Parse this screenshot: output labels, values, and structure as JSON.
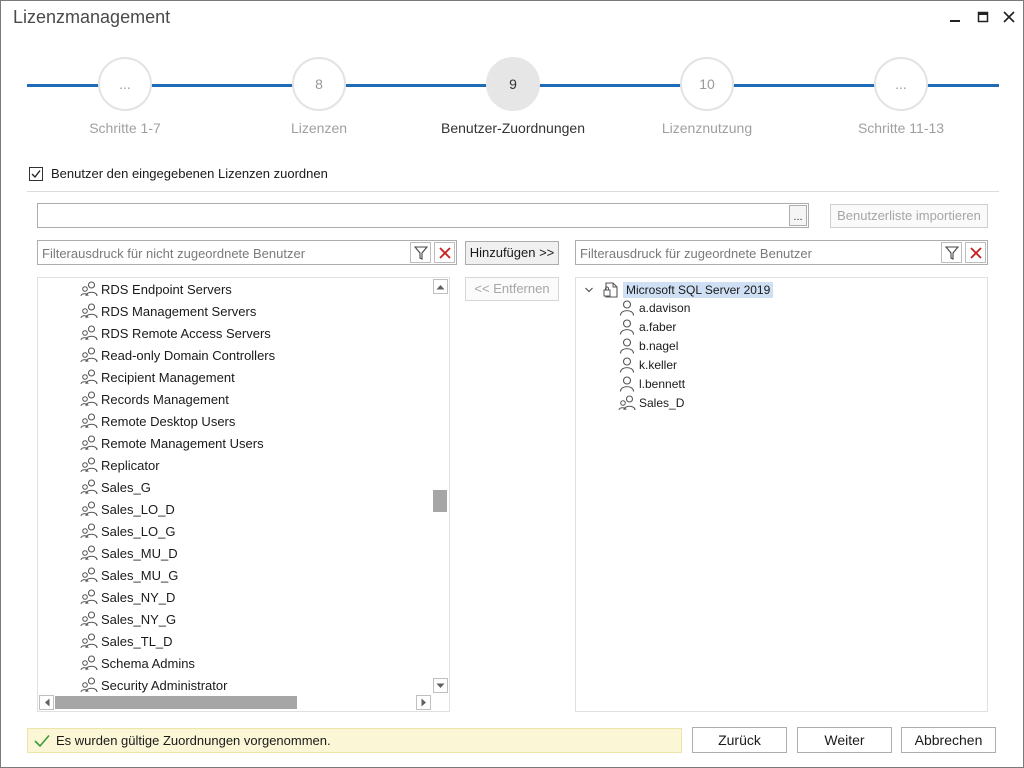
{
  "window": {
    "title": "Lizenzmanagement"
  },
  "colors": {
    "accent": "#1e6bb8",
    "status_bg": "#fbf7d6",
    "selected_bg": "#cfe0f5",
    "delete_red": "#c81e1e"
  },
  "stepper": {
    "steps": [
      {
        "number": "...",
        "label": "Schritte 1-7",
        "active": false
      },
      {
        "number": "8",
        "label": "Lizenzen",
        "active": false
      },
      {
        "number": "9",
        "label": "Benutzer-Zuordnungen",
        "active": true
      },
      {
        "number": "10",
        "label": "Lizenznutzung",
        "active": false
      },
      {
        "number": "...",
        "label": "Schritte 11-13",
        "active": false
      }
    ]
  },
  "assign_checkbox": {
    "label": "Benutzer den eingegebenen Lizenzen zuordnen",
    "checked": true
  },
  "path_input": {
    "value": "",
    "browse_label": "..."
  },
  "import_button": {
    "label": "Benutzerliste importieren",
    "enabled": false
  },
  "left_filter": {
    "placeholder": "Filterausdruck für nicht zugeordnete Benutzer",
    "icons": [
      "filter-icon",
      "clear-filter-icon"
    ]
  },
  "right_filter": {
    "placeholder": "Filterausdruck für zugeordnete Benutzer",
    "icons": [
      "filter-icon",
      "clear-filter-icon"
    ]
  },
  "add_button": {
    "label": "Hinzufügen >>"
  },
  "remove_button": {
    "label": "<< Entfernen",
    "enabled": false
  },
  "unassigned_list": {
    "items": [
      "RDS Endpoint Servers",
      "RDS Management Servers",
      "RDS Remote Access Servers",
      "Read-only Domain Controllers",
      "Recipient Management",
      "Records Management",
      "Remote Desktop Users",
      "Remote Management Users",
      "Replicator",
      "Sales_G",
      "Sales_LO_D",
      "Sales_LO_G",
      "Sales_MU_D",
      "Sales_MU_G",
      "Sales_NY_D",
      "Sales_NY_G",
      "Sales_TL_D",
      "Schema Admins",
      "Security Administrator"
    ],
    "item_icon": "group-icon"
  },
  "assigned_tree": {
    "root": {
      "label": "Microsoft SQL Server 2019",
      "icon": "license-icon",
      "expanded": true
    },
    "children": [
      {
        "label": "a.davison",
        "icon": "user-icon"
      },
      {
        "label": "a.faber",
        "icon": "user-icon"
      },
      {
        "label": "b.nagel",
        "icon": "user-icon"
      },
      {
        "label": "k.keller",
        "icon": "user-icon"
      },
      {
        "label": "l.bennett",
        "icon": "user-icon"
      },
      {
        "label": "Sales_D",
        "icon": "group-icon"
      }
    ]
  },
  "status": {
    "text": "Es wurden gültige Zuordnungen vorgenommen.",
    "icon": "checkmark-icon"
  },
  "buttons": {
    "back": "Zurück",
    "next": "Weiter",
    "cancel": "Abbrechen"
  }
}
